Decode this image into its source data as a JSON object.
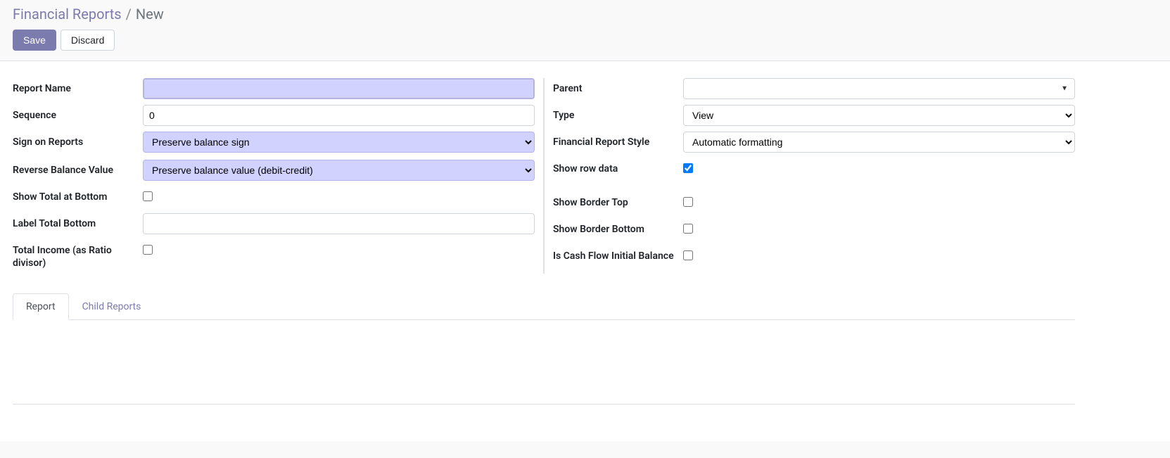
{
  "breadcrumb": {
    "parent": "Financial Reports",
    "separator": "/",
    "current": "New"
  },
  "buttons": {
    "save": "Save",
    "discard": "Discard"
  },
  "left_fields": {
    "report_name": {
      "label": "Report Name",
      "value": ""
    },
    "sequence": {
      "label": "Sequence",
      "value": "0"
    },
    "sign_on_reports": {
      "label": "Sign on Reports",
      "value": "Preserve balance sign"
    },
    "reverse_balance_value": {
      "label": "Reverse Balance Value",
      "value": "Preserve balance value (debit-credit)"
    },
    "show_total_bottom": {
      "label": "Show Total at Bottom",
      "checked": false
    },
    "label_total_bottom": {
      "label": "Label Total Bottom",
      "value": ""
    },
    "total_income_ratio": {
      "label": "Total Income (as Ratio divisor)",
      "checked": false
    }
  },
  "right_fields": {
    "parent": {
      "label": "Parent",
      "value": ""
    },
    "type": {
      "label": "Type",
      "value": "View"
    },
    "financial_report_style": {
      "label": "Financial Report Style",
      "value": "Automatic formatting"
    },
    "show_row_data": {
      "label": "Show row data",
      "checked": true
    },
    "show_border_top": {
      "label": "Show Border Top",
      "checked": false
    },
    "show_border_bottom": {
      "label": "Show Border Bottom",
      "checked": false
    },
    "is_cash_flow_initial": {
      "label": "Is Cash Flow Initial Balance",
      "checked": false
    }
  },
  "tabs": {
    "report": "Report",
    "child_reports": "Child Reports"
  }
}
